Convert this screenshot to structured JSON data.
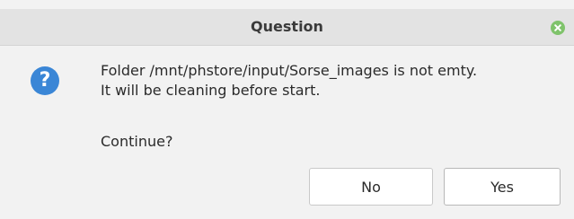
{
  "window": {
    "title": "Question"
  },
  "message": {
    "line1": "Folder /mnt/phstore/input/Sorse_images is not emty.",
    "line2": "It will be cleaning before start.",
    "prompt": "Continue?"
  },
  "icon": {
    "name": "question-icon",
    "glyph": "?",
    "color": "#3a86d6"
  },
  "buttons": {
    "no_label": "No",
    "yes_label": "Yes"
  },
  "colors": {
    "close_button": "#7fc36b",
    "titlebar": "#e3e3e3",
    "body": "#f2f2f2"
  }
}
